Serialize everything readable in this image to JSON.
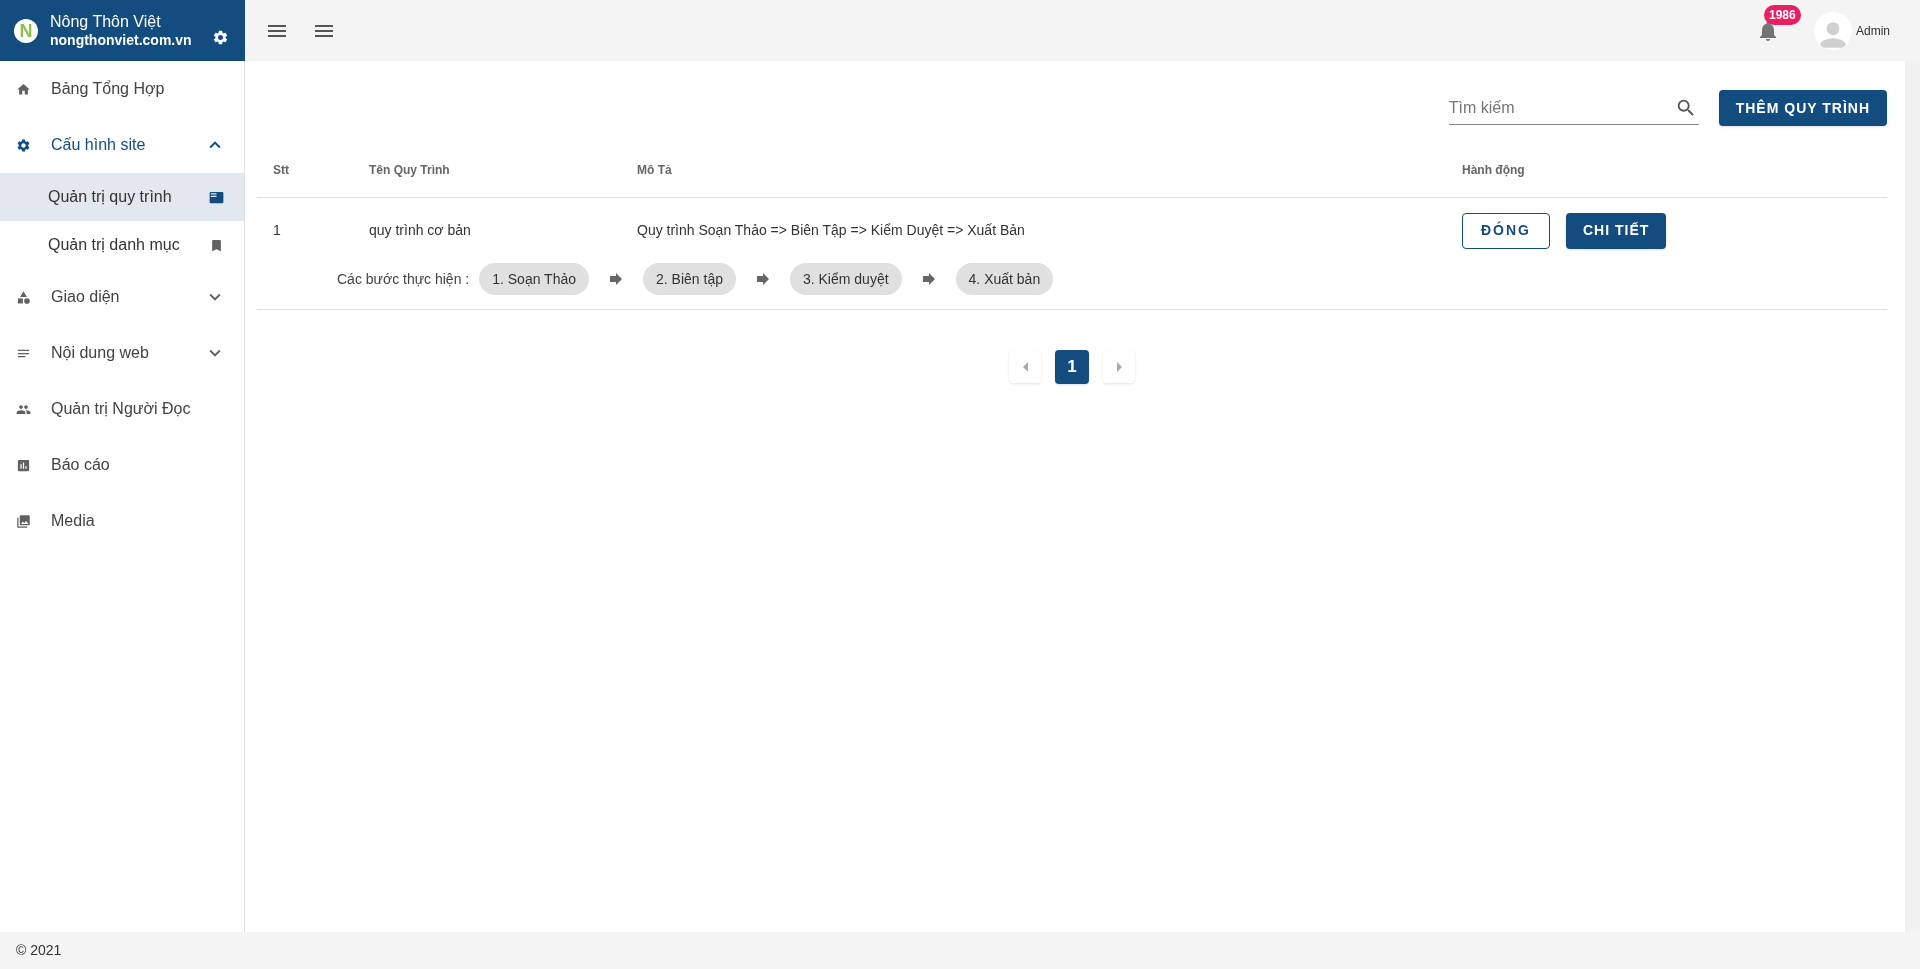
{
  "brand": {
    "name": "Nông Thôn Việt",
    "domain": "nongthonviet.com.vn",
    "logo_letter": "N"
  },
  "sidebar": {
    "items": [
      {
        "label": "Bảng Tổng Hợp",
        "selected": false
      },
      {
        "label": "Cấu hình site",
        "selected": false,
        "expanded": true,
        "children": [
          {
            "label": "Quản trị quy trình",
            "selected": true
          },
          {
            "label": "Quản trị danh mục",
            "selected": false
          }
        ]
      },
      {
        "label": "Giao diện",
        "selected": false,
        "expanded": false
      },
      {
        "label": "Nội dung web",
        "selected": false,
        "expanded": false
      },
      {
        "label": "Quản trị Người Đọc",
        "selected": false
      },
      {
        "label": "Báo cáo",
        "selected": false
      },
      {
        "label": "Media",
        "selected": false
      }
    ]
  },
  "topbar": {
    "notifications": "1986",
    "user": "Admin"
  },
  "toolbar": {
    "search": {
      "placeholder": "Tìm kiếm"
    },
    "add_button": "THÊM QUY TRÌNH"
  },
  "table": {
    "columns": [
      "Stt",
      "Tên Quy Trình",
      "Mô Tả",
      "Hành động"
    ],
    "rows": [
      {
        "stt": "1",
        "name": "quy trình cơ bản",
        "description": "Quy trình Soạn Thảo => Biên Tập => Kiểm Duyệt => Xuất Bản",
        "actions": [
          "ĐÓNG",
          "CHI TIẾT"
        ],
        "steps_label": "Các bước thực hiện :",
        "steps": [
          "1. Soạn Thảo",
          "2. Biên tập",
          "3. Kiểm duyệt",
          "4. Xuất bản"
        ]
      }
    ]
  },
  "pagination": {
    "pages": [
      {
        "label": "1",
        "selected": true
      }
    ]
  },
  "footer": "© 2021"
}
